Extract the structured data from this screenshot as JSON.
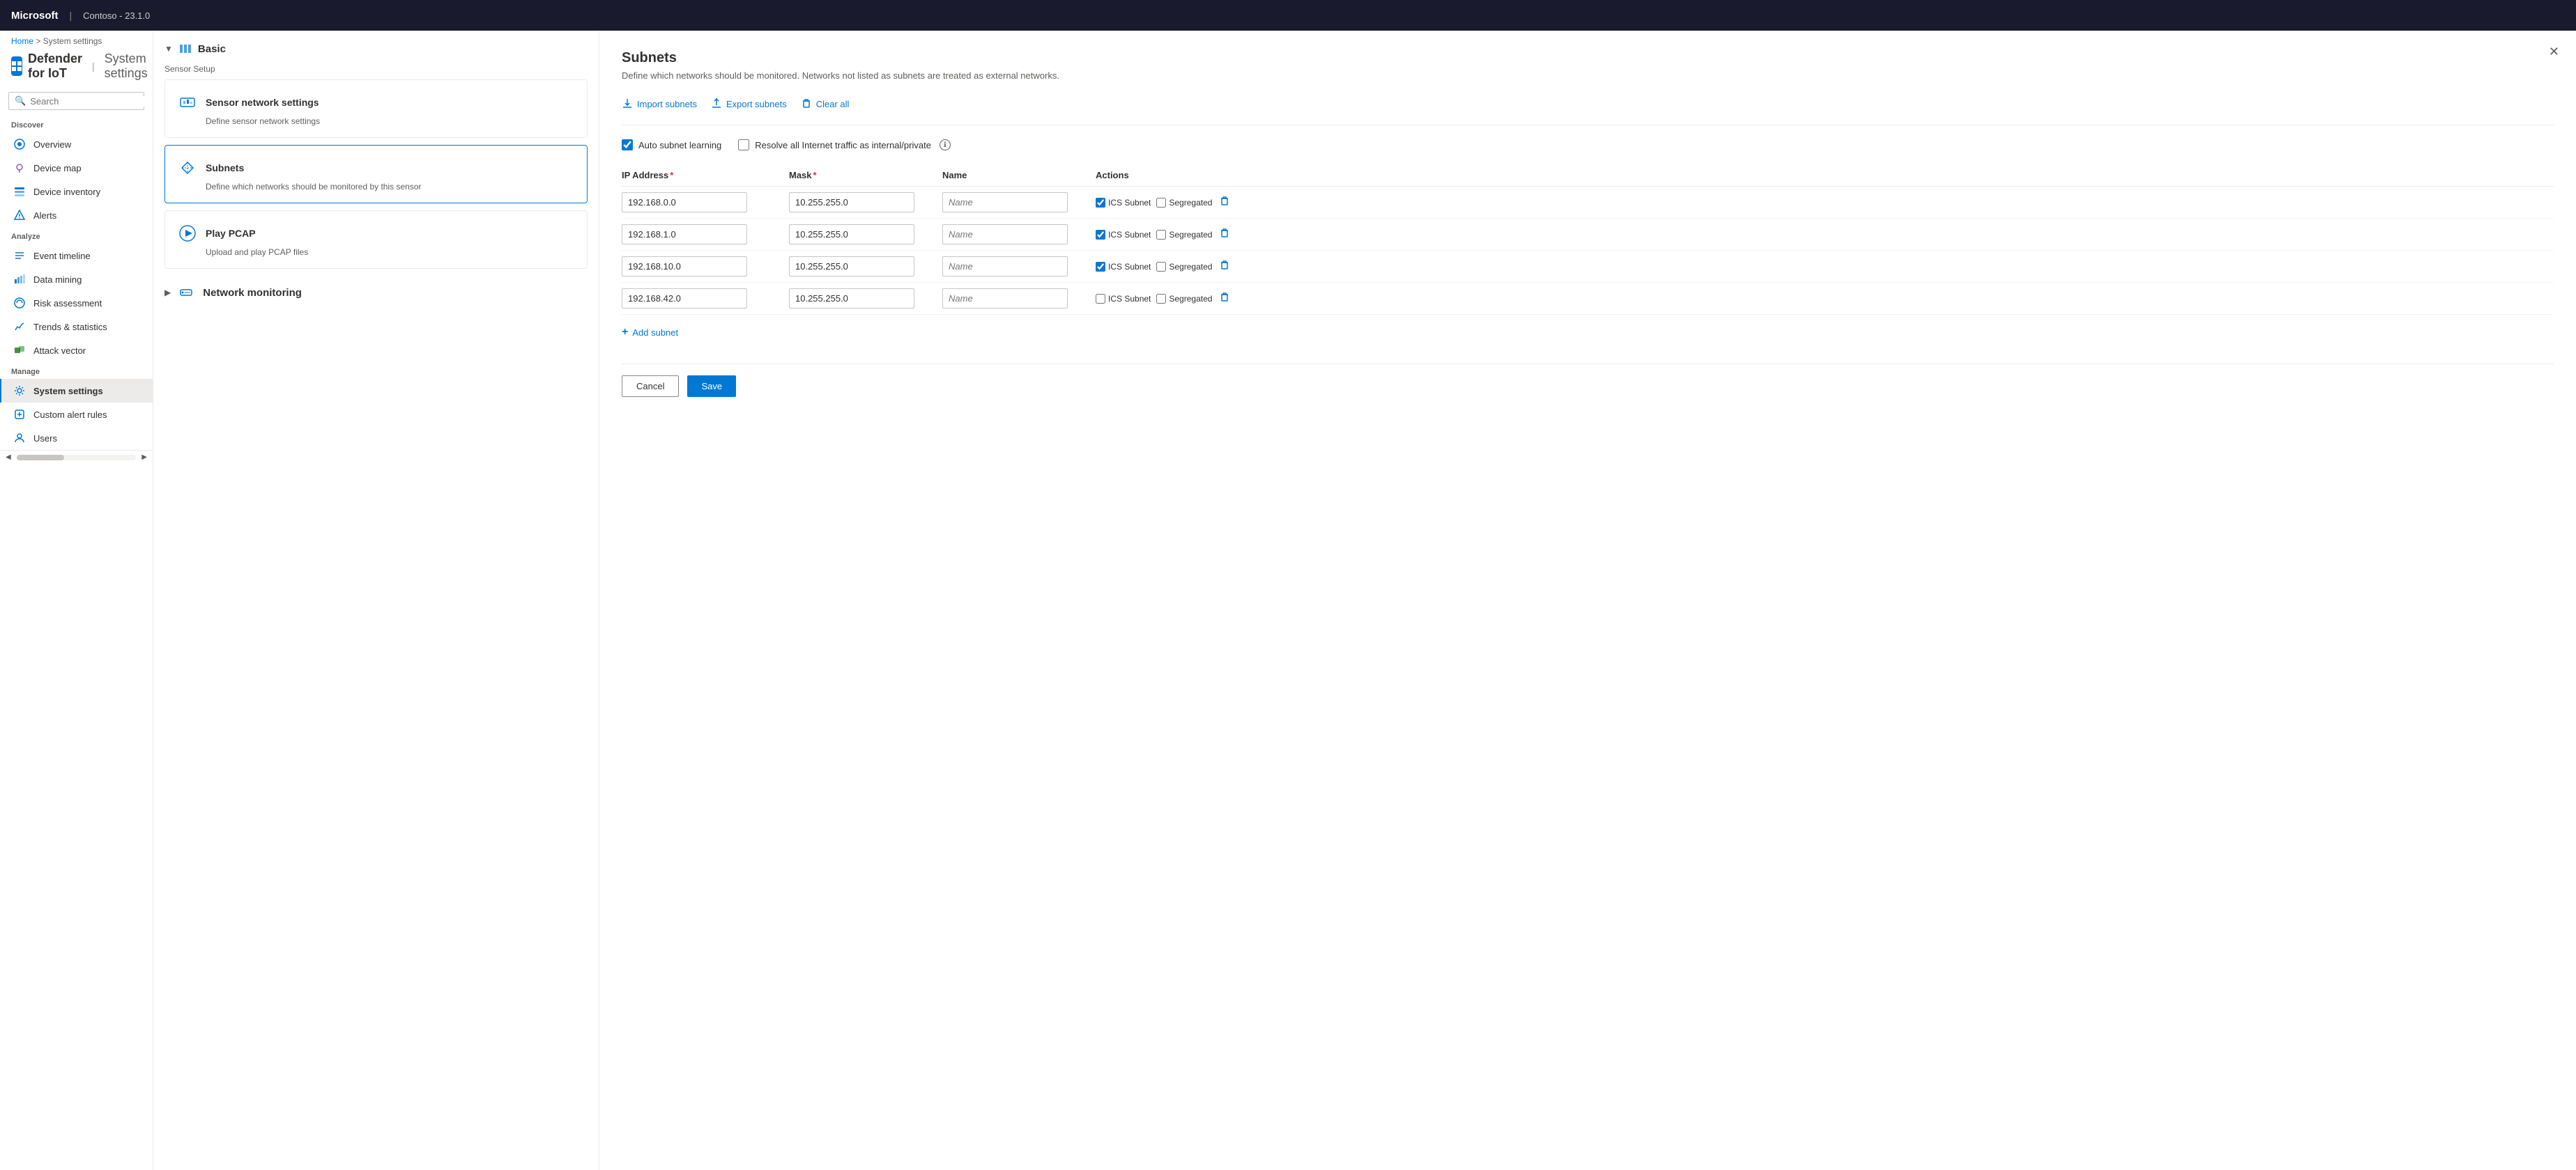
{
  "topbar": {
    "brand": "Microsoft",
    "divider": "|",
    "instance": "Contoso - 23.1.0"
  },
  "breadcrumb": {
    "home": "Home",
    "separator": ">",
    "current": "System settings"
  },
  "pageTitle": {
    "main": "Defender for IoT",
    "divider": "|",
    "sub": "System settings"
  },
  "search": {
    "placeholder": "Search"
  },
  "sidebar": {
    "discover": {
      "label": "Discover",
      "items": [
        {
          "id": "overview",
          "label": "Overview"
        },
        {
          "id": "device-map",
          "label": "Device map"
        },
        {
          "id": "device-inventory",
          "label": "Device inventory"
        },
        {
          "id": "alerts",
          "label": "Alerts"
        }
      ]
    },
    "analyze": {
      "label": "Analyze",
      "items": [
        {
          "id": "event-timeline",
          "label": "Event timeline"
        },
        {
          "id": "data-mining",
          "label": "Data mining"
        },
        {
          "id": "risk-assessment",
          "label": "Risk assessment"
        },
        {
          "id": "trends-statistics",
          "label": "Trends & statistics"
        },
        {
          "id": "attack-vector",
          "label": "Attack vector"
        }
      ]
    },
    "manage": {
      "label": "Manage",
      "items": [
        {
          "id": "system-settings",
          "label": "System settings",
          "active": true
        },
        {
          "id": "custom-alert-rules",
          "label": "Custom alert rules"
        },
        {
          "id": "users",
          "label": "Users"
        }
      ]
    }
  },
  "settingsPanel": {
    "basicSection": {
      "label": "Basic",
      "sensorSetup": "Sensor Setup",
      "cards": [
        {
          "id": "sensor-network",
          "title": "Sensor network settings",
          "desc": "Define sensor network settings"
        },
        {
          "id": "subnets",
          "title": "Subnets",
          "desc": "Define which networks should be monitored by this sensor"
        },
        {
          "id": "play-pcap",
          "title": "Play PCAP",
          "desc": "Upload and play PCAP files"
        }
      ]
    },
    "networkMonitoring": {
      "label": "Network monitoring"
    }
  },
  "subnetsPanel": {
    "title": "Subnets",
    "description": "Define which networks should be monitored. Networks not listed as subnets are treated as external networks.",
    "toolbar": {
      "importLabel": "Import subnets",
      "exportLabel": "Export subnets",
      "clearAllLabel": "Clear all"
    },
    "options": {
      "autoSubnetLearning": "Auto subnet learning",
      "autoSubnetChecked": true,
      "resolveInternet": "Resolve all Internet traffic as internal/private",
      "resolveInternetChecked": false
    },
    "tableHeaders": {
      "ipAddress": "IP Address",
      "mask": "Mask",
      "name": "Name",
      "actions": "Actions"
    },
    "rows": [
      {
        "ip": "192.168.0.0",
        "mask": "10.255.255.0",
        "name": "",
        "icsSubnet": true,
        "segregated": false
      },
      {
        "ip": "192.168.1.0",
        "mask": "10.255.255.0",
        "name": "",
        "icsSubnet": true,
        "segregated": false
      },
      {
        "ip": "192.168.10.0",
        "mask": "10.255.255.0",
        "name": "",
        "icsSubnet": true,
        "segregated": false
      },
      {
        "ip": "192.168.42.0",
        "mask": "10.255.255.0",
        "name": "",
        "icsSubnet": false,
        "segregated": false
      }
    ],
    "addSubnet": "Add subnet",
    "namePlaceholder": "Name",
    "icsSubnetLabel": "ICS Subnet",
    "segregatedLabel": "Segregated",
    "cancelLabel": "Cancel",
    "saveLabel": "Save"
  }
}
